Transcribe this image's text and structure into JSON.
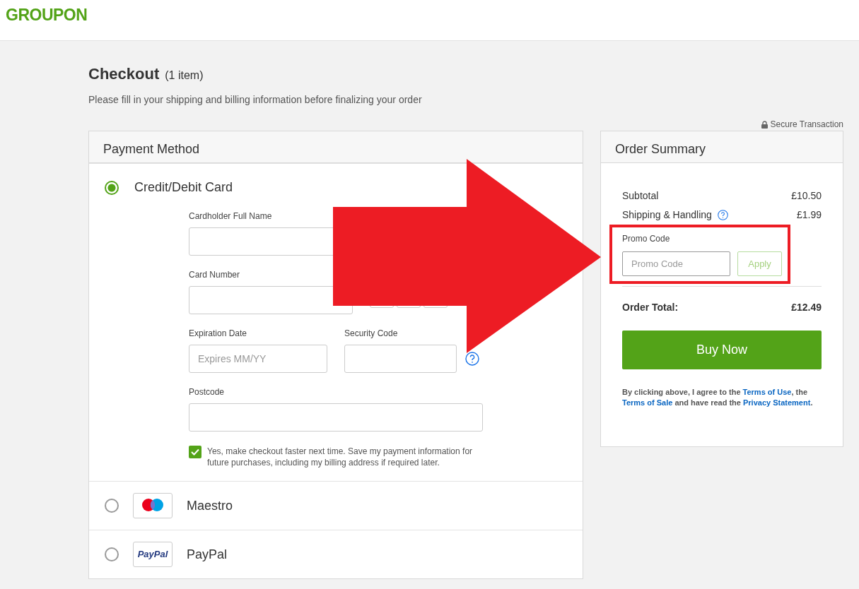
{
  "header": {
    "logo": "GROUPON"
  },
  "page": {
    "title": "Checkout",
    "item_count": "(1 item)",
    "subtitle": "Please fill in your shipping and billing information before finalizing your order",
    "secure_note": "Secure Transaction"
  },
  "payment": {
    "title": "Payment Method",
    "methods": [
      {
        "kind": "card",
        "label": "Credit/Debit Card",
        "selected": true
      },
      {
        "kind": "maestro",
        "label": "Maestro",
        "selected": false
      },
      {
        "kind": "paypal",
        "label": "PayPal",
        "logo_text": "PayPal",
        "selected": false
      }
    ],
    "fields": [
      {
        "kind": "name",
        "label": "Cardholder Full Name"
      },
      {
        "kind": "number",
        "label": "Card Number"
      },
      {
        "kind": "expiry",
        "label": "Expiration Date",
        "placeholder": "Expires MM/YY"
      },
      {
        "kind": "cvc",
        "label": "Security Code"
      },
      {
        "kind": "postcode",
        "label": "Postcode"
      }
    ],
    "save_option": {
      "text": "Yes, make checkout faster next time. Save my payment information for future purchases, including my billing address if required later.",
      "checked": true
    }
  },
  "summary": {
    "title": "Order Summary",
    "lines": [
      {
        "label": "Subtotal",
        "amount": "£10.50"
      },
      {
        "label": "Shipping & Handling",
        "amount": "£1.99",
        "help": true
      }
    ],
    "promo": {
      "label": "Promo Code",
      "placeholder": "Promo Code",
      "button": "Apply"
    },
    "total": {
      "label": "Order Total:",
      "amount": "£12.49"
    },
    "button": "Buy Now",
    "terms": [
      {
        "kind": "text",
        "text": "By clicking above, I agree to the "
      },
      {
        "kind": "link",
        "text": "Terms of Use"
      },
      {
        "kind": "text",
        "text": ", the "
      },
      {
        "kind": "link",
        "text": "Terms of Sale"
      },
      {
        "kind": "text",
        "text": " and have read the "
      },
      {
        "kind": "link",
        "text": "Privacy Statement"
      },
      {
        "kind": "text",
        "text": "."
      }
    ]
  },
  "annotations": {
    "arrow": true,
    "frame": true
  }
}
